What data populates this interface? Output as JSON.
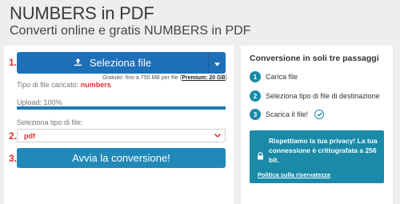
{
  "header": {
    "title": "NUMBERS in PDF",
    "subtitle": "Converti online e gratis NUMBERS in PDF"
  },
  "steps_markers": [
    "1.",
    "2.",
    "3."
  ],
  "upload": {
    "select_button_label": "Seleziona file",
    "free_note_prefix": "Gratuito: fino a 750 MB per file (",
    "free_note_premium": "Premium: 20 GB",
    "free_note_suffix": ")",
    "file_type_label": "Tipo di file caricato:",
    "file_type_value": "numbers",
    "upload_label": "Upload: 100%",
    "upload_progress": 1.0
  },
  "target": {
    "label": "Seleziona tipo di file:",
    "selected": "pdf"
  },
  "convert_button_label": "Avvia la conversione!",
  "sidebar": {
    "title": "Conversione in soli tre passaggi",
    "steps": [
      {
        "num": "1",
        "label": "Carica file"
      },
      {
        "num": "2",
        "label": "Seleziona tipo di file di destinazione"
      },
      {
        "num": "3",
        "label": "Scarica il file!"
      }
    ],
    "privacy_text": "Rispettiamo la tua privacy! La tua connessione è crittografata a 256 bit.",
    "privacy_link": "Politica sulla riservatezza"
  },
  "colors": {
    "primary_blue": "#1f6fb8",
    "teal": "#1a8aa8",
    "accent_red": "#e03030"
  }
}
